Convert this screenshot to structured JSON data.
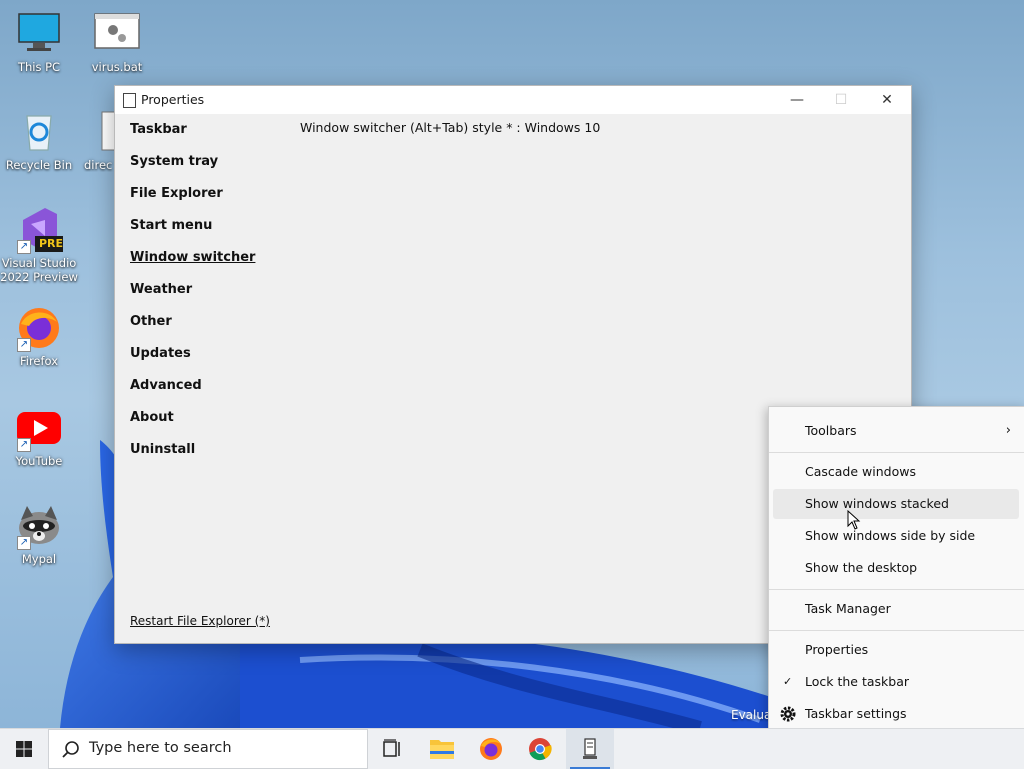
{
  "desktop_icons": [
    {
      "label": "This PC",
      "icon": "monitor-icon"
    },
    {
      "label": "virus.bat",
      "icon": "batch-file-icon"
    },
    {
      "label": "Recycle Bin",
      "icon": "recycle-bin-icon"
    },
    {
      "label": "direc",
      "icon": "document-icon"
    },
    {
      "label": "Visual Studio 2022 Preview",
      "badge": "PRE",
      "icon": "visual-studio-icon"
    },
    {
      "label": "Firefox",
      "icon": "firefox-icon"
    },
    {
      "label": "YouTube",
      "icon": "youtube-icon"
    },
    {
      "label": "Mypal",
      "icon": "raccoon-icon"
    }
  ],
  "window": {
    "title": "Properties",
    "nav": [
      "Taskbar",
      "System tray",
      "File Explorer",
      "Start menu",
      "Window switcher",
      "Weather",
      "Other",
      "Updates",
      "Advanced",
      "About",
      "Uninstall"
    ],
    "active_nav": "Window switcher",
    "setting_text": "Window switcher (Alt+Tab) style * : Windows 10",
    "restart_link": "Restart File Explorer (*)"
  },
  "context_menu": {
    "items": [
      "Toolbars",
      "Cascade windows",
      "Show windows stacked",
      "Show windows side by side",
      "Show the desktop",
      "Task Manager",
      "Properties",
      "Lock the taskbar",
      "Taskbar settings"
    ],
    "hovered": "Show windows stacked",
    "checked": "Lock the taskbar",
    "submenu_arrow": "›",
    "check_mark": "✓"
  },
  "watermark": "Evaluat",
  "taskbar": {
    "search_placeholder": "Type here to search",
    "apps": [
      "task-view-icon",
      "file-explorer-icon",
      "firefox-icon",
      "chrome-icon",
      "properties-app-icon"
    ]
  },
  "colors": {
    "accent": "#3a7bd5",
    "wallpaper_blue": "#1f5fe0"
  }
}
